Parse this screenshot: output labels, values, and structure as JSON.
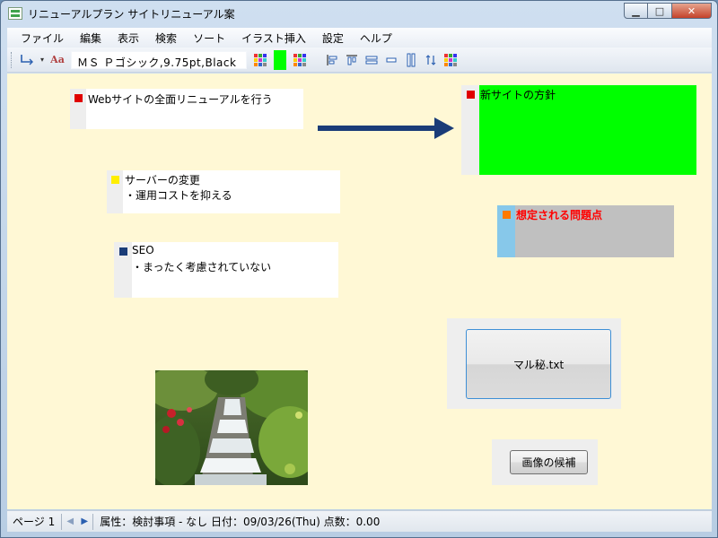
{
  "window": {
    "title": "リニューアルプラン  サイトリニューアル案",
    "buttons": {
      "minimize": "▭",
      "maximize": "□",
      "close": "✕"
    }
  },
  "menu": {
    "items": [
      "ファイル",
      "編集",
      "表示",
      "検索",
      "ソート",
      "イラスト挿入",
      "設定",
      "ヘルプ"
    ]
  },
  "toolbar": {
    "connector_icon": "connector-icon",
    "font_icon_label": "Aa",
    "font_value": "ＭＳ Ｐゴシック,9.75pt,Black",
    "swatch_color": "#00ff00"
  },
  "cards": {
    "renewal": {
      "text": "Webサイトの全面リニューアルを行う",
      "marker_color": "#e00000"
    },
    "server": {
      "line1": "サーバーの変更",
      "line2": "・運用コストを抑える",
      "marker_color": "#ffee00"
    },
    "seo": {
      "line1": "SEO",
      "line2": "・まったく考慮されていない",
      "marker_color": "#1a3c78"
    },
    "policy": {
      "text": "新サイトの方針",
      "marker_color": "#e00000",
      "fill": "#00ff00"
    },
    "issues": {
      "text": "想定される問題点",
      "marker_color": "#ff7a00",
      "text_color": "#ff0000",
      "fill": "#c0c0c0",
      "gutter": "#87c8ea"
    }
  },
  "file_button": {
    "label": "マル秘.txt"
  },
  "image_candidates_button": {
    "label": "画像の候補"
  },
  "arrow_color": "#1a3c78",
  "status": {
    "page": "ページ 1",
    "info": "属性：検討事項 - なし  日付：09/03/26(Thu)  点数：0.00"
  }
}
